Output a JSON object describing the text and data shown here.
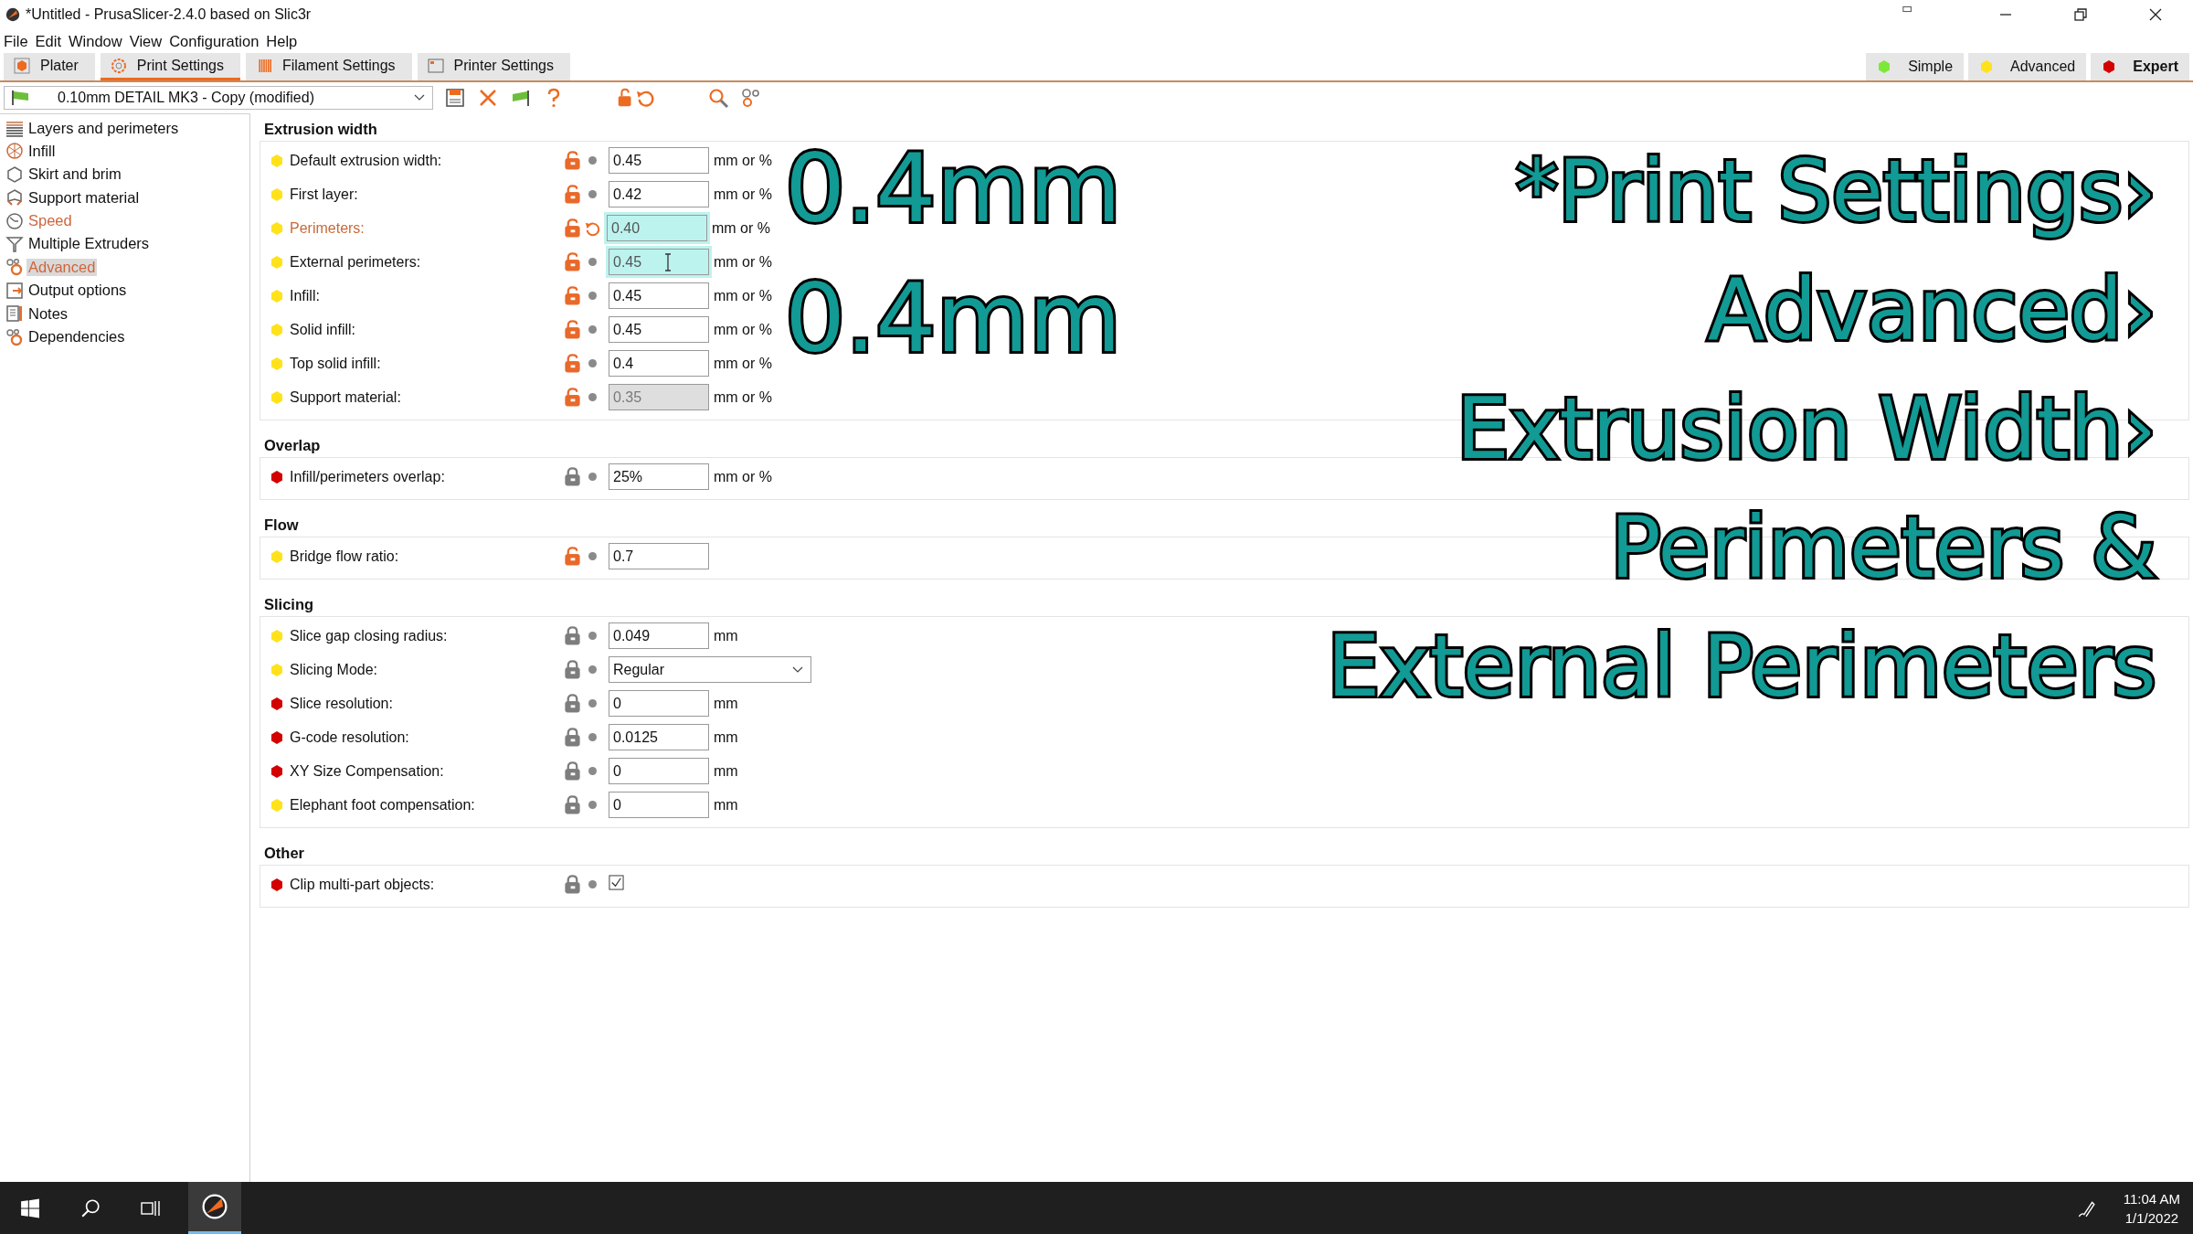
{
  "window": {
    "title": "*Untitled - PrusaSlicer-2.4.0 based on Slic3r"
  },
  "menu": [
    "File",
    "Edit",
    "Window",
    "View",
    "Configuration",
    "Help"
  ],
  "tabs": [
    {
      "label": "Plater",
      "selected": false
    },
    {
      "label": "Print Settings",
      "selected": true
    },
    {
      "label": "Filament Settings",
      "selected": false
    },
    {
      "label": "Printer Settings",
      "selected": false
    }
  ],
  "modes": [
    {
      "label": "Simple",
      "color": "#7ee83a",
      "selected": false
    },
    {
      "label": "Advanced",
      "color": "#ffe21a",
      "selected": false
    },
    {
      "label": "Expert",
      "color": "#d40000",
      "selected": true
    }
  ],
  "preset": {
    "value": "0.10mm DETAIL MK3 - Copy (modified)"
  },
  "sidebar": {
    "items": [
      {
        "label": "Layers and perimeters",
        "selected": false,
        "modified": false
      },
      {
        "label": "Infill",
        "selected": false,
        "modified": false
      },
      {
        "label": "Skirt and brim",
        "selected": false,
        "modified": false
      },
      {
        "label": "Support material",
        "selected": false,
        "modified": false
      },
      {
        "label": "Speed",
        "selected": false,
        "modified": true
      },
      {
        "label": "Multiple Extruders",
        "selected": false,
        "modified": false
      },
      {
        "label": "Advanced",
        "selected": true,
        "modified": true
      },
      {
        "label": "Output options",
        "selected": false,
        "modified": false
      },
      {
        "label": "Notes",
        "selected": false,
        "modified": false
      },
      {
        "label": "Dependencies",
        "selected": false,
        "modified": false
      }
    ]
  },
  "sections": [
    {
      "title": "Extrusion width",
      "rows": [
        {
          "kind": "input",
          "label": "Default extrusion width:",
          "color": "#ffe21a",
          "locked": false,
          "modified": false,
          "value": "0.45",
          "unit": "mm or %",
          "highlighted": false
        },
        {
          "kind": "input",
          "label": "First layer:",
          "color": "#ffe21a",
          "locked": false,
          "modified": false,
          "value": "0.42",
          "unit": "mm or %",
          "highlighted": false
        },
        {
          "kind": "input",
          "label": "Perimeters:",
          "color": "#ffe21a",
          "locked": false,
          "modified": true,
          "value": "0.40",
          "unit": "mm or %",
          "highlighted": true
        },
        {
          "kind": "input",
          "label": "External perimeters:",
          "color": "#ffe21a",
          "locked": false,
          "modified": false,
          "value": "0.45",
          "unit": "mm or %",
          "highlighted": true,
          "text_cursor": true
        },
        {
          "kind": "input",
          "label": "Infill:",
          "color": "#ffe21a",
          "locked": false,
          "modified": false,
          "value": "0.45",
          "unit": "mm or %",
          "highlighted": false
        },
        {
          "kind": "input",
          "label": "Solid infill:",
          "color": "#ffe21a",
          "locked": false,
          "modified": false,
          "value": "0.45",
          "unit": "mm or %",
          "highlighted": false
        },
        {
          "kind": "input",
          "label": "Top solid infill:",
          "color": "#ffe21a",
          "locked": false,
          "modified": false,
          "value": "0.4",
          "unit": "mm or %",
          "highlighted": false
        },
        {
          "kind": "input",
          "label": "Support material:",
          "color": "#ffe21a",
          "locked": false,
          "modified": false,
          "value": "0.35",
          "unit": "mm or %",
          "highlighted": false,
          "disabled": true
        }
      ]
    },
    {
      "title": "Overlap",
      "rows": [
        {
          "kind": "input",
          "label": "Infill/perimeters overlap:",
          "color": "#d40000",
          "locked": true,
          "modified": false,
          "value": "25%",
          "unit": "mm or %",
          "highlighted": false
        }
      ]
    },
    {
      "title": "Flow",
      "rows": [
        {
          "kind": "input",
          "label": "Bridge flow ratio:",
          "color": "#ffe21a",
          "locked": false,
          "modified": false,
          "value": "0.7",
          "highlighted": false
        }
      ]
    },
    {
      "title": "Slicing",
      "rows": [
        {
          "kind": "input",
          "label": "Slice gap closing radius:",
          "color": "#ffe21a",
          "locked": true,
          "modified": false,
          "value": "0.049",
          "unit": "mm",
          "highlighted": false
        },
        {
          "kind": "select",
          "label": "Slicing Mode:",
          "color": "#ffe21a",
          "locked": true,
          "modified": false,
          "value": "Regular",
          "highlighted": false
        },
        {
          "kind": "input",
          "label": "Slice resolution:",
          "color": "#d40000",
          "locked": true,
          "modified": false,
          "value": "0",
          "unit": "mm",
          "highlighted": false
        },
        {
          "kind": "input",
          "label": "G-code resolution:",
          "color": "#d40000",
          "locked": true,
          "modified": false,
          "value": "0.0125",
          "unit": "mm",
          "highlighted": false
        },
        {
          "kind": "input",
          "label": "XY Size Compensation:",
          "color": "#d40000",
          "locked": true,
          "modified": false,
          "value": "0",
          "unit": "mm",
          "highlighted": false
        },
        {
          "kind": "input",
          "label": "Elephant foot compensation:",
          "color": "#ffe21a",
          "locked": true,
          "modified": false,
          "value": "0",
          "unit": "mm",
          "highlighted": false
        }
      ]
    },
    {
      "title": "Other",
      "rows": [
        {
          "kind": "checkbox",
          "label": "Clip multi-part objects:",
          "color": "#d40000",
          "locked": true,
          "modified": false,
          "checked": true,
          "highlighted": false
        }
      ]
    }
  ],
  "overlay": {
    "left": [
      "0.4mm",
      "0.4mm"
    ],
    "right": [
      "*Print Settings›",
      "Advanced›",
      "Extrusion Width›",
      "Perimeters &",
      "External Perimeters"
    ]
  },
  "taskbar": {
    "time": "11:04 AM",
    "date": "1/1/2022"
  }
}
